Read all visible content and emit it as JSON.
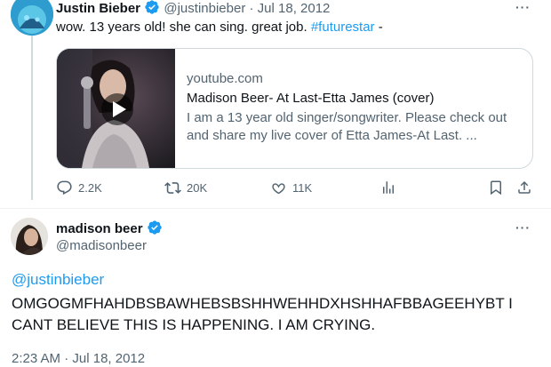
{
  "first_tweet": {
    "author_name": "Justin Bieber",
    "handle": "@justinbieber",
    "separator": "·",
    "date": "Jul 18, 2012",
    "text_pre": "wow. 13 years old! she can sing. great job. ",
    "hashtag": "#futurestar",
    "text_post": " -",
    "card": {
      "domain": "youtube.com",
      "title": "Madison Beer- At Last-Etta James (cover)",
      "description": "I am a 13 year old singer/songwriter. Please check out and share my live cover of Etta James-At Last. ..."
    },
    "actions": {
      "replies": "2.2K",
      "reposts": "20K",
      "likes": "11K"
    },
    "more_icon": "more-icon"
  },
  "second_tweet": {
    "author_name": "madison beer",
    "handle": "@madisonbeer",
    "mention": "@justinbieber",
    "body": "OMGOGMFHAHDBSBAWHEBSBSHHWEHHDXHSHHAFBBAGEEHYBT I CANT BELIEVE THIS IS HAPPENING. I AM CRYING.",
    "time": "2:23 AM",
    "separator": "·",
    "date": "Jul 18, 2012"
  },
  "colors": {
    "accent": "#1d9bf0",
    "muted": "#536471",
    "border": "#cfd9de",
    "text": "#0f1419"
  }
}
